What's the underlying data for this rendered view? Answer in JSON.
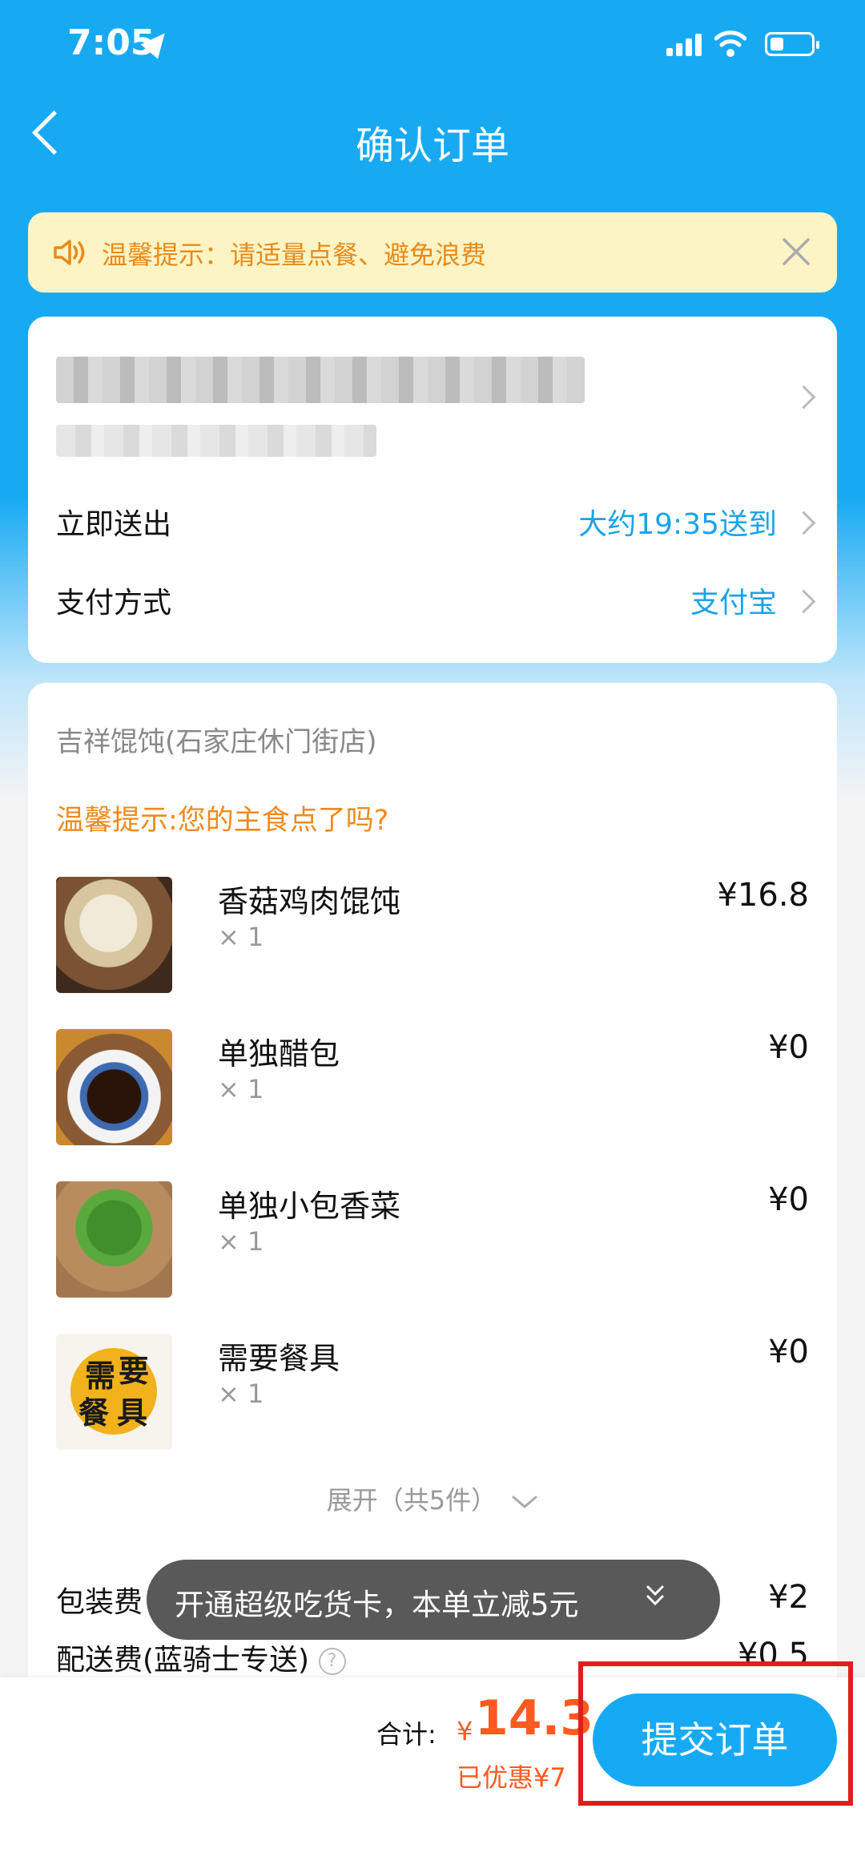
{
  "status_bar": {
    "time": "7:05"
  },
  "header": {
    "title": "确认订单"
  },
  "notice": {
    "text": "温馨提示：请适量点餐、避免浪费"
  },
  "delivery": {
    "label": "立即送出",
    "value": "大约19:35送到"
  },
  "payment": {
    "label": "支付方式",
    "value": "支付宝"
  },
  "order": {
    "shop": "吉祥馄饨(石家庄休门街店)",
    "hint": "温馨提示:您的主食点了吗?",
    "items": [
      {
        "name": "香菇鸡肉馄饨",
        "qty": "× 1",
        "price": "¥16.8"
      },
      {
        "name": "单独醋包",
        "qty": "× 1",
        "price": "¥0"
      },
      {
        "name": "单独小包香菜",
        "qty": "× 1",
        "price": "¥0"
      },
      {
        "name": "需要餐具",
        "qty": "× 1",
        "price": "¥0",
        "image_text": "需要餐具"
      }
    ],
    "expand": "展开（共5件）",
    "fees": [
      {
        "label": "包装费",
        "value": "¥2"
      },
      {
        "label": "配送费(蓝骑士专送)",
        "value": "¥0.5"
      }
    ]
  },
  "promo": {
    "text": "开通超级吃货卡，本单立减5元"
  },
  "footer": {
    "total_label": "合计:",
    "currency": "¥",
    "total": "14.3",
    "saved": "已优惠¥7",
    "submit": "提交订单"
  },
  "colors": {
    "brand": "#17aaf3",
    "accent": "#ff5a1f",
    "hint": "#f08a1c",
    "highlight": "#e01e1e"
  }
}
